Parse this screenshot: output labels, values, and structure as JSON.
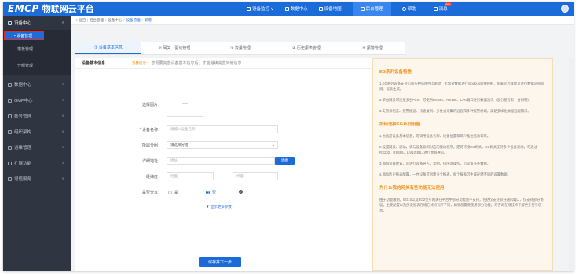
{
  "app": {
    "logo_mark": "EMCP",
    "title": "物联网云平台"
  },
  "topnav": {
    "items": [
      {
        "label": "设备监控 ∨",
        "icon": "monitor-icon"
      },
      {
        "label": "数据中心",
        "icon": "chart-icon"
      },
      {
        "label": "设备地图",
        "icon": "map-pin-icon"
      },
      {
        "label": "后台管理",
        "icon": "settings-icon",
        "active": true
      },
      {
        "label": "帮助",
        "icon": "help-icon"
      },
      {
        "label": "消息",
        "icon": "message-icon",
        "badge": "99+"
      }
    ]
  },
  "sidebar": {
    "group": {
      "label": "设备中心",
      "chevron": "∧"
    },
    "subitems": [
      {
        "label": "• 设备管理",
        "active": true
      },
      {
        "label": "模板管理"
      },
      {
        "label": "分组管理"
      }
    ],
    "items": [
      {
        "label": "数据中心",
        "chevron": "∨"
      },
      {
        "label": "GMP中心",
        "chevron": "∨"
      },
      {
        "label": "账号管理",
        "chevron": "∨"
      },
      {
        "label": "组织架构",
        "chevron": "∨"
      },
      {
        "label": "运维管理",
        "chevron": "∨"
      },
      {
        "label": "扩展功能",
        "chevron": "∨"
      },
      {
        "label": "增值服务",
        "chevron": "∨"
      }
    ]
  },
  "breadcrumb": {
    "back": "< 返回",
    "items": [
      "后台管理",
      "设备中心",
      "设备管理",
      "新增"
    ]
  },
  "tabs": [
    {
      "label": "① 设备基本信息",
      "active": true
    },
    {
      "label": "② 网关、驱动管理"
    },
    {
      "label": "③ 变量管理"
    },
    {
      "label": "④ 历史报表管理"
    },
    {
      "label": "⑤ 报警管理"
    }
  ],
  "form": {
    "section_title": "设备基本信息",
    "hint_label": "温馨提示：",
    "hint_text": "您需要完善设备基本信息后，才能继续完善其他信息",
    "image_label": "选择图片：",
    "upload_symbol": "+",
    "name_label": "设备名称：",
    "name_placeholder": "请输入设备名称",
    "group_label": "所属分组：",
    "group_value": "请选择分组",
    "address_label": "详细地址：",
    "address_placeholder": "地址",
    "map_button": "地图",
    "coords_label": "经纬度：",
    "lng_placeholder": "经度",
    "lat_placeholder": "纬度",
    "share_label": "是否分享：",
    "share_yes": "是",
    "share_no": "否",
    "more_link": "▼ 显示更多参数",
    "save_button": "保存并下一步"
  },
  "info": {
    "h1": "EG系列设备特性",
    "p1": "1.EG系列设备支持市面多种品牌PLC驱动，无需对数据进行modbus转换映射，配置完后就能可进行数据远程监测、报表生成。",
    "p2": "2.单台网关可连接多台PLC，可使用RS232、RS485、LAN端口进行数据通讯（部分型号有一台限制）。",
    "p3": "3.支持云组态、报警推送、快速复制、多维式采集的远程和多种报警终端，满足多样化数据远程需求。",
    "h2": "如何选择EG系列设备",
    "p4": "1.也就是设备基本信息，可调用设备名称、设备位置和简介备注信息等等。",
    "p5": "2.设置网关、驱动，请与设备联网对应的驱动程序，定可将接EG网关，EG网关支持多个设备驱动，可通过RS232、RS485、LAN等端口进行数据通讯。",
    "p6": "3.添加设备配置，可进行设备导入、复制、排序等操作，可设置多条数组。",
    "p7": "4.添加历史报表配置，一台设备可创建多个报表，每个报表可生成存储不同的设置数据。",
    "h3": "为什么我的网关有些功能无法使用",
    "p8": "由于功能限制，EG10以及EG2型号网关在平台中部分功能暂不支持，包括仅支持部分通讯端口、仅支持部分协议，主要配置以及历史报表存储方式均有所不同，如果您需要使用部分功能，可咨询在线技术了解更多型号信息。"
  }
}
